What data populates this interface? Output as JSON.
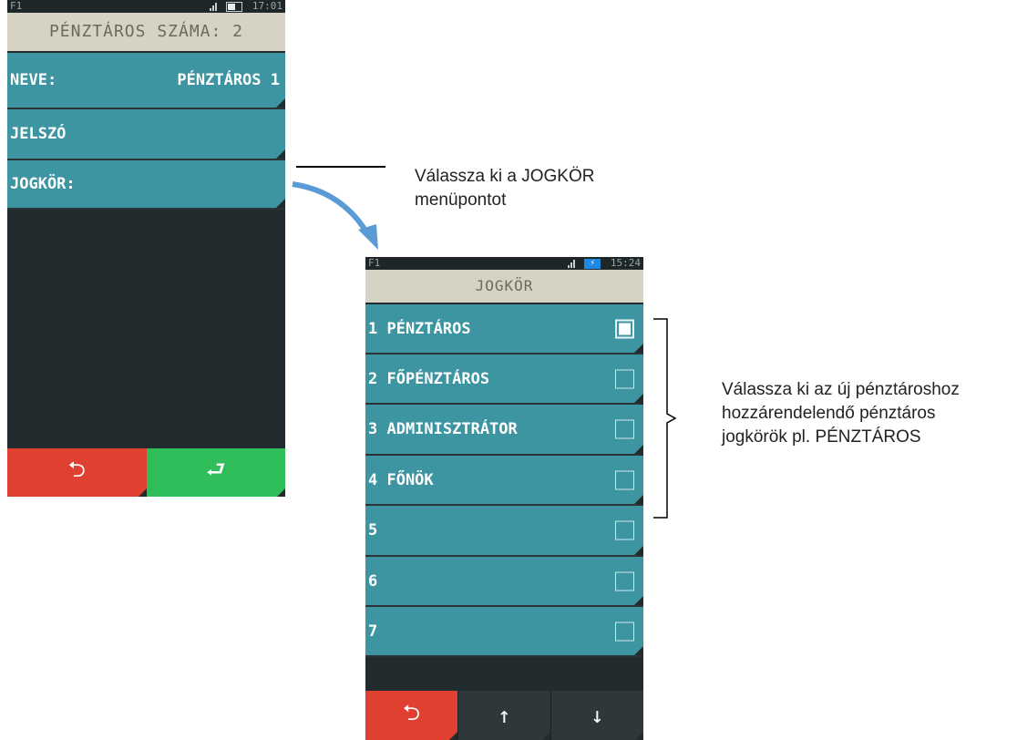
{
  "screen1": {
    "status": {
      "left": "F1",
      "time": "17:01"
    },
    "header": "PÉNZTÁROS SZÁMA: 2",
    "rows": [
      {
        "label": "NEVE:",
        "value": "PÉNZTÁROS 1"
      },
      {
        "label": "JELSZÓ",
        "value": ""
      },
      {
        "label": "JOGKÖR:",
        "value": ""
      }
    ],
    "buttons": {
      "back": "⮌",
      "enter": "⮐"
    }
  },
  "screen2": {
    "status": {
      "left": "F1",
      "time": "15:24",
      "battery": "charging"
    },
    "header": "JOGKÖR",
    "items": [
      {
        "label": "1 PÉNZTÁROS",
        "checked": true
      },
      {
        "label": "2 FŐPÉNZTÁROS",
        "checked": false
      },
      {
        "label": "3 ADMINISZTRÁTOR",
        "checked": false
      },
      {
        "label": "4 FŐNÖK",
        "checked": false
      },
      {
        "label": "5",
        "checked": false
      },
      {
        "label": "6",
        "checked": false
      },
      {
        "label": "7",
        "checked": false
      }
    ],
    "buttons": {
      "back": "⮌",
      "up": "↑",
      "down": "↓"
    }
  },
  "annotations": {
    "step1": [
      "Válassza ki a JOGKÖR",
      "menüpontot"
    ],
    "step2": [
      "Válassza ki az új pénztároshoz",
      "hozzárendelendő pénztáros",
      "jogkörök pl. PÉNZTÁROS"
    ]
  },
  "colors": {
    "item_bg": "#3c95a1",
    "screen_bg": "#222b2d",
    "header_bg": "#d7d3c4",
    "back_button": "#e0402f",
    "enter_button": "#2fbe5a",
    "arrow": "#5b9bd5"
  }
}
